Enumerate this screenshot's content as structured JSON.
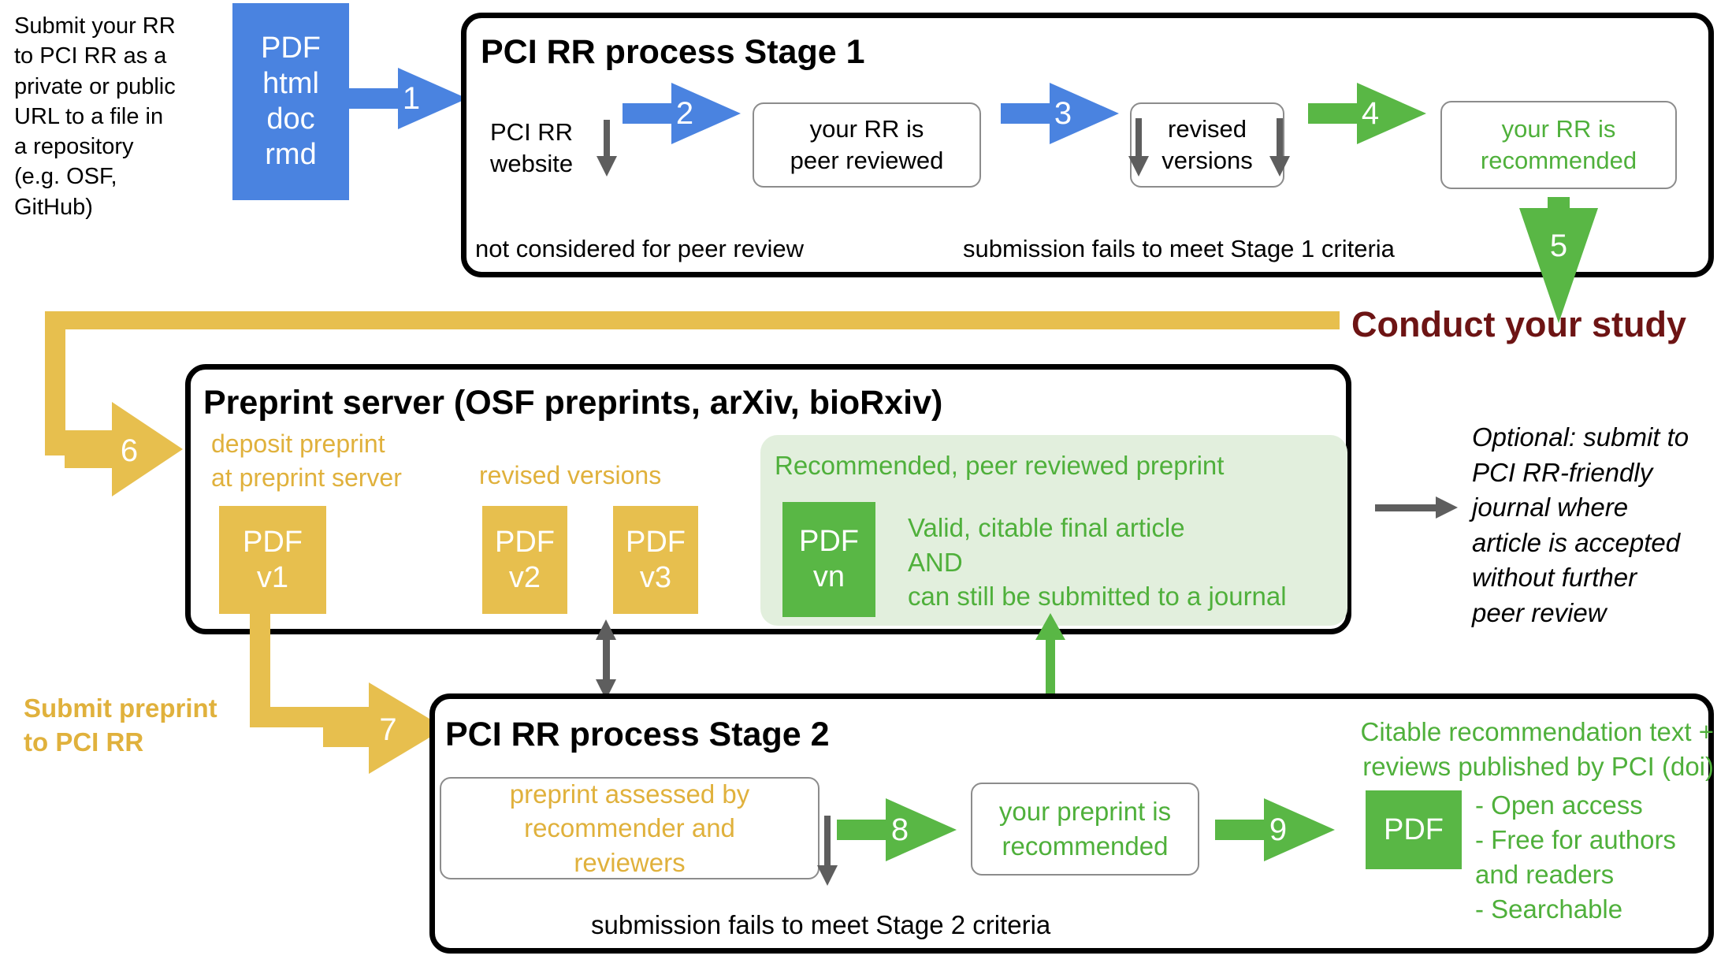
{
  "intro": {
    "note": "Submit your RR\nto PCI RR as a\nprivate or public\nURL to a file in\na repository\n(e.g. OSF,\nGitHub)",
    "file_chip": "PDF\nhtml\ndoc\nrmd"
  },
  "stage1": {
    "title": "PCI RR process Stage 1",
    "website_label": "PCI RR\nwebsite",
    "box_peer_reviewed": "your RR is\npeer reviewed",
    "box_revised_versions": "revised\nversions",
    "box_recommended": "your RR is\nrecommended",
    "fail_left": "not considered for peer review",
    "fail_right": "submission fails to meet Stage 1 criteria",
    "arrows": [
      {
        "num": "1",
        "color": "#4a83e0"
      },
      {
        "num": "2",
        "color": "#4a83e0"
      },
      {
        "num": "3",
        "color": "#4a83e0"
      },
      {
        "num": "4",
        "color": "#59b745"
      },
      {
        "num": "5",
        "color": "#59b745"
      }
    ]
  },
  "conduct": {
    "label": "Conduct your study"
  },
  "preprint": {
    "title": "Preprint server (OSF preprints, arXiv, bioRxiv)",
    "deposit_label": "deposit preprint\nat preprint server",
    "revised_label": "revised versions",
    "chips": [
      {
        "type": "PDF",
        "version": "v1"
      },
      {
        "type": "PDF",
        "version": "v2"
      },
      {
        "type": "PDF",
        "version": "v3"
      },
      {
        "type": "PDF",
        "version": "vn"
      }
    ],
    "green_panel": {
      "heading": "Recommended, peer reviewed preprint",
      "body": "Valid, citable final article\nAND\ncan still be submitted to a journal"
    },
    "arrow6": {
      "num": "6",
      "color": "#e7bf4e"
    }
  },
  "optional": {
    "text": "Optional: submit to\nPCI RR-friendly\njournal where\narticle is accepted\nwithout further\npeer review"
  },
  "submit_preprint": {
    "label": "Submit preprint\nto PCI RR",
    "arrow7": {
      "num": "7",
      "color": "#e7bf4e"
    }
  },
  "stage2": {
    "title": "PCI RR process Stage 2",
    "box_assessed": "preprint assessed by\nrecommender and\nreviewers",
    "box_recommended": "your preprint is\nrecommended",
    "fail_text": "submission fails to meet Stage 2 criteria",
    "citable_heading": "Citable recommendation text +\nreviews published by PCI (doi)",
    "bullets": "- Open access\n- Free for authors\nand readers\n- Searchable",
    "pdf_chip": "PDF",
    "arrows": [
      {
        "num": "8",
        "color": "#59b745"
      },
      {
        "num": "9",
        "color": "#59b745"
      }
    ]
  },
  "colors": {
    "blue": "#4a83e0",
    "green": "#59b745",
    "green_text": "#4fb03b",
    "yellow": "#e7bf4e",
    "yellow_text": "#e0b13c",
    "grey_arrow": "#5e5e5e",
    "maroon": "#6d1414",
    "green_panel_bg": "#e2efdd"
  }
}
